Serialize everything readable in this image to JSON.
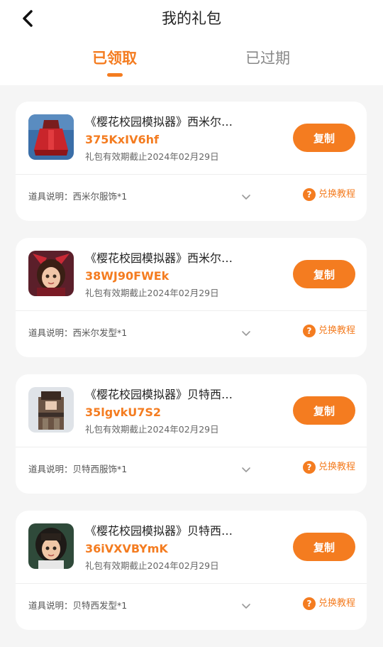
{
  "header": {
    "title": "我的礼包",
    "tabs": [
      {
        "label": "已领取"
      },
      {
        "label": "已过期"
      }
    ]
  },
  "copy_label": "复制",
  "howto_label": "兑换教程",
  "gifts": [
    {
      "name": "《樱花校园模拟器》西米尔…",
      "code": "375KxIV6hf",
      "expiry": "礼包有效期截止2024年02月29日",
      "desc": "道具说明：西米尔服饰*1"
    },
    {
      "name": "《樱花校园模拟器》西米尔…",
      "code": "38WJ90FWEk",
      "expiry": "礼包有效期截止2024年02月29日",
      "desc": "道具说明：西米尔发型*1"
    },
    {
      "name": "《樱花校园模拟器》贝特西…",
      "code": "35lgvkU7S2",
      "expiry": "礼包有效期截止2024年02月29日",
      "desc": "道具说明：贝特西服饰*1"
    },
    {
      "name": "《樱花校园模拟器》贝特西…",
      "code": "36iVXVBYmK",
      "expiry": "礼包有效期截止2024年02月29日",
      "desc": "道具说明：贝特西发型*1"
    }
  ]
}
